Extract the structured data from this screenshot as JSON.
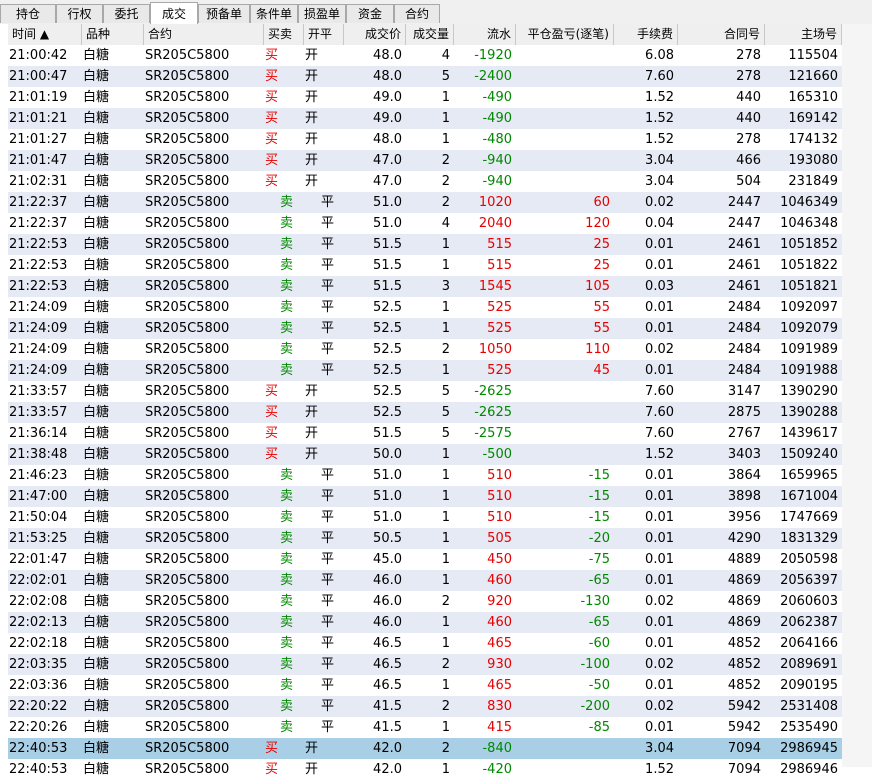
{
  "tabs": [
    "持仓",
    "行权",
    "委托",
    "成交",
    "预备单",
    "条件单",
    "损盈单",
    "资金",
    "合约"
  ],
  "active_tab": "成交",
  "columns": [
    "时间 ▲",
    "品种",
    "合约",
    "买卖",
    "开平",
    "成交价",
    "成交量",
    "流水",
    "平仓盈亏(逐笔)",
    "手续费",
    "合同号",
    "主场号"
  ],
  "rows": [
    [
      "21:00:42",
      "白糖",
      "SR205C5800",
      "买",
      "开",
      "48.0",
      "4",
      "-1920",
      "",
      "6.08",
      "278",
      "115504"
    ],
    [
      "21:00:47",
      "白糖",
      "SR205C5800",
      "买",
      "开",
      "48.0",
      "5",
      "-2400",
      "",
      "7.60",
      "278",
      "121660"
    ],
    [
      "21:01:19",
      "白糖",
      "SR205C5800",
      "买",
      "开",
      "49.0",
      "1",
      "-490",
      "",
      "1.52",
      "440",
      "165310"
    ],
    [
      "21:01:21",
      "白糖",
      "SR205C5800",
      "买",
      "开",
      "49.0",
      "1",
      "-490",
      "",
      "1.52",
      "440",
      "169142"
    ],
    [
      "21:01:27",
      "白糖",
      "SR205C5800",
      "买",
      "开",
      "48.0",
      "1",
      "-480",
      "",
      "1.52",
      "278",
      "174132"
    ],
    [
      "21:01:47",
      "白糖",
      "SR205C5800",
      "买",
      "开",
      "47.0",
      "2",
      "-940",
      "",
      "3.04",
      "466",
      "193080"
    ],
    [
      "21:02:31",
      "白糖",
      "SR205C5800",
      "买",
      "开",
      "47.0",
      "2",
      "-940",
      "",
      "3.04",
      "504",
      "231849"
    ],
    [
      "21:22:37",
      "白糖",
      "SR205C5800",
      "卖",
      "平",
      "51.0",
      "2",
      "1020",
      "60",
      "0.02",
      "2447",
      "1046349"
    ],
    [
      "21:22:37",
      "白糖",
      "SR205C5800",
      "卖",
      "平",
      "51.0",
      "4",
      "2040",
      "120",
      "0.04",
      "2447",
      "1046348"
    ],
    [
      "21:22:53",
      "白糖",
      "SR205C5800",
      "卖",
      "平",
      "51.5",
      "1",
      "515",
      "25",
      "0.01",
      "2461",
      "1051852"
    ],
    [
      "21:22:53",
      "白糖",
      "SR205C5800",
      "卖",
      "平",
      "51.5",
      "1",
      "515",
      "25",
      "0.01",
      "2461",
      "1051822"
    ],
    [
      "21:22:53",
      "白糖",
      "SR205C5800",
      "卖",
      "平",
      "51.5",
      "3",
      "1545",
      "105",
      "0.03",
      "2461",
      "1051821"
    ],
    [
      "21:24:09",
      "白糖",
      "SR205C5800",
      "卖",
      "平",
      "52.5",
      "1",
      "525",
      "55",
      "0.01",
      "2484",
      "1092097"
    ],
    [
      "21:24:09",
      "白糖",
      "SR205C5800",
      "卖",
      "平",
      "52.5",
      "1",
      "525",
      "55",
      "0.01",
      "2484",
      "1092079"
    ],
    [
      "21:24:09",
      "白糖",
      "SR205C5800",
      "卖",
      "平",
      "52.5",
      "2",
      "1050",
      "110",
      "0.02",
      "2484",
      "1091989"
    ],
    [
      "21:24:09",
      "白糖",
      "SR205C5800",
      "卖",
      "平",
      "52.5",
      "1",
      "525",
      "45",
      "0.01",
      "2484",
      "1091988"
    ],
    [
      "21:33:57",
      "白糖",
      "SR205C5800",
      "买",
      "开",
      "52.5",
      "5",
      "-2625",
      "",
      "7.60",
      "3147",
      "1390290"
    ],
    [
      "21:33:57",
      "白糖",
      "SR205C5800",
      "买",
      "开",
      "52.5",
      "5",
      "-2625",
      "",
      "7.60",
      "2875",
      "1390288"
    ],
    [
      "21:36:14",
      "白糖",
      "SR205C5800",
      "买",
      "开",
      "51.5",
      "5",
      "-2575",
      "",
      "7.60",
      "2767",
      "1439617"
    ],
    [
      "21:38:48",
      "白糖",
      "SR205C5800",
      "买",
      "开",
      "50.0",
      "1",
      "-500",
      "",
      "1.52",
      "3403",
      "1509240"
    ],
    [
      "21:46:23",
      "白糖",
      "SR205C5800",
      "卖",
      "平",
      "51.0",
      "1",
      "510",
      "-15",
      "0.01",
      "3864",
      "1659965"
    ],
    [
      "21:47:00",
      "白糖",
      "SR205C5800",
      "卖",
      "平",
      "51.0",
      "1",
      "510",
      "-15",
      "0.01",
      "3898",
      "1671004"
    ],
    [
      "21:50:04",
      "白糖",
      "SR205C5800",
      "卖",
      "平",
      "51.0",
      "1",
      "510",
      "-15",
      "0.01",
      "3956",
      "1747669"
    ],
    [
      "21:53:25",
      "白糖",
      "SR205C5800",
      "卖",
      "平",
      "50.5",
      "1",
      "505",
      "-20",
      "0.01",
      "4290",
      "1831329"
    ],
    [
      "22:01:47",
      "白糖",
      "SR205C5800",
      "卖",
      "平",
      "45.0",
      "1",
      "450",
      "-75",
      "0.01",
      "4889",
      "2050598"
    ],
    [
      "22:02:01",
      "白糖",
      "SR205C5800",
      "卖",
      "平",
      "46.0",
      "1",
      "460",
      "-65",
      "0.01",
      "4869",
      "2056397"
    ],
    [
      "22:02:08",
      "白糖",
      "SR205C5800",
      "卖",
      "平",
      "46.0",
      "2",
      "920",
      "-130",
      "0.02",
      "4869",
      "2060603"
    ],
    [
      "22:02:13",
      "白糖",
      "SR205C5800",
      "卖",
      "平",
      "46.0",
      "1",
      "460",
      "-65",
      "0.01",
      "4869",
      "2062387"
    ],
    [
      "22:02:18",
      "白糖",
      "SR205C5800",
      "卖",
      "平",
      "46.5",
      "1",
      "465",
      "-60",
      "0.01",
      "4852",
      "2064166"
    ],
    [
      "22:03:35",
      "白糖",
      "SR205C5800",
      "卖",
      "平",
      "46.5",
      "2",
      "930",
      "-100",
      "0.02",
      "4852",
      "2089691"
    ],
    [
      "22:03:36",
      "白糖",
      "SR205C5800",
      "卖",
      "平",
      "46.5",
      "1",
      "465",
      "-50",
      "0.01",
      "4852",
      "2090195"
    ],
    [
      "22:20:22",
      "白糖",
      "SR205C5800",
      "卖",
      "平",
      "41.5",
      "2",
      "830",
      "-200",
      "0.02",
      "5942",
      "2531408"
    ],
    [
      "22:20:26",
      "白糖",
      "SR205C5800",
      "卖",
      "平",
      "41.5",
      "1",
      "415",
      "-85",
      "0.01",
      "5942",
      "2535490"
    ],
    [
      "22:40:53",
      "白糖",
      "SR205C5800",
      "买",
      "开",
      "42.0",
      "2",
      "-840",
      "",
      "3.04",
      "7094",
      "2986945"
    ],
    [
      "22:40:53",
      "白糖",
      "SR205C5800",
      "买",
      "开",
      "42.0",
      "1",
      "-420",
      "",
      "1.52",
      "7094",
      "2986946"
    ]
  ],
  "selected_row": 33,
  "colors": {
    "red": "#e60000",
    "green": "#008800",
    "row_alt": "#e6eaf4",
    "selected": "#a9cfe6"
  }
}
